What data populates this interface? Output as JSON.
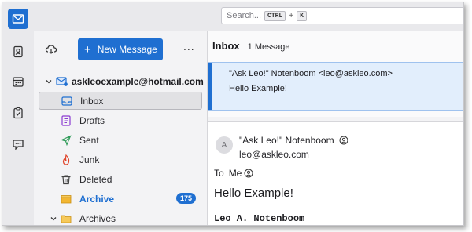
{
  "search": {
    "placeholder": "Search...",
    "key1": "CTRL",
    "plus": "+",
    "key2": "K"
  },
  "toolbar": {
    "new_message_label": "New Message",
    "more_label": "..."
  },
  "account": {
    "name": "askleoexample@hotmail.com"
  },
  "folders": [
    {
      "label": "Inbox",
      "icon": "inbox-icon",
      "selected": true
    },
    {
      "label": "Drafts",
      "icon": "drafts-icon"
    },
    {
      "label": "Sent",
      "icon": "sent-icon"
    },
    {
      "label": "Junk",
      "icon": "junk-icon"
    },
    {
      "label": "Deleted",
      "icon": "trash-icon"
    },
    {
      "label": "Archive",
      "icon": "archive-icon",
      "bold": true,
      "count": "175"
    },
    {
      "label": "Archives",
      "icon": "folder-icon"
    }
  ],
  "message_list": {
    "title": "Inbox",
    "count_text": "1 Message",
    "messages": [
      {
        "from": "\"Ask Leo!\" Notenboom <leo@askleo.com>",
        "subject": "Hello Example!"
      }
    ]
  },
  "preview": {
    "avatar": "A",
    "from_name": "\"Ask Leo!\" Notenboom",
    "from_address": "leo@askleo.com",
    "to_label": "To",
    "to_value": "Me",
    "subject": "Hello Example!",
    "body_first_line": "Leo A. Notenboom"
  },
  "colors": {
    "accent": "#1f6fd1",
    "selected_row": "#e2eefc",
    "junk": "#e0452b",
    "sent": "#2f9b59",
    "drafts": "#8a3ad1",
    "archive_folder": "#f2b632"
  }
}
